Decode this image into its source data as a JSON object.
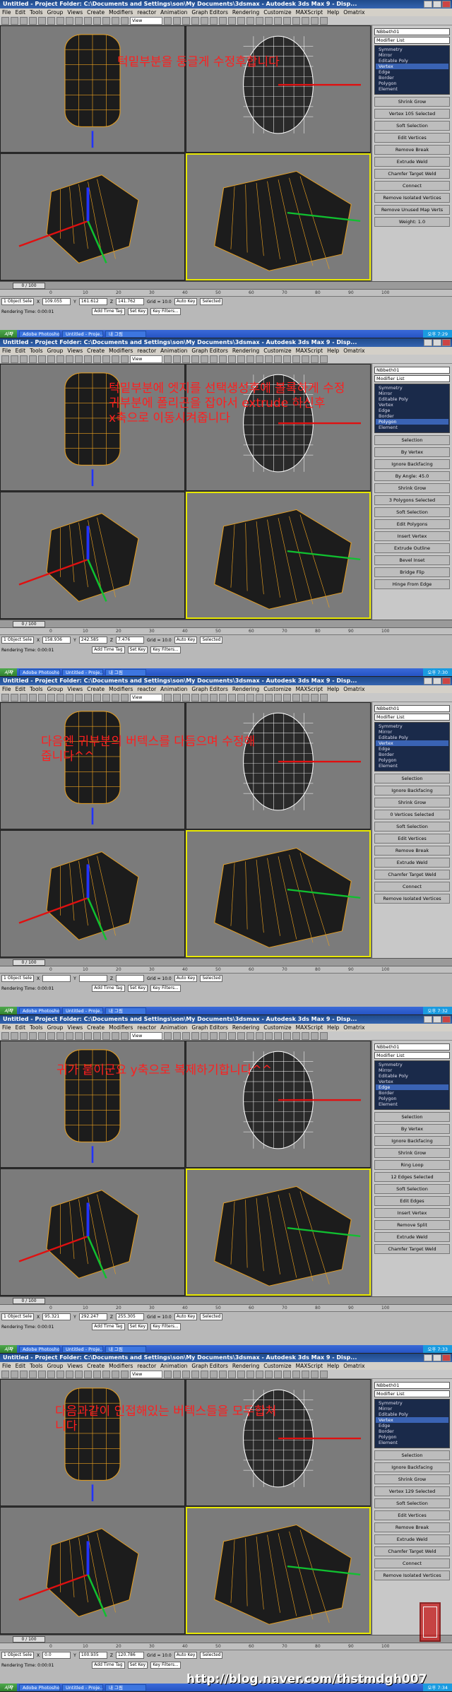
{
  "app": {
    "window_title": "Untitled   - Project Folder: C:\\Documents and Settings\\son\\My Documents\\3dsmax   - Autodesk 3ds Max 9   - Disp...",
    "menus": [
      "File",
      "Edit",
      "Tools",
      "Group",
      "Views",
      "Create",
      "Modifiers",
      "reactor",
      "Animation",
      "Graph Editors",
      "Rendering",
      "Customize",
      "MAXScript",
      "Help",
      "Omatrix"
    ],
    "viewport_label": "View",
    "object_name": "NBbeth01",
    "modifier_list": "Modifier List"
  },
  "frames": [
    {
      "note": "턱밑부분을 둥글게 수정후합니다",
      "stack": [
        "Symmetry",
        "Mirror",
        "Editable Poly",
        "Vertex",
        "Edge",
        "Border",
        "Polygon",
        "Element"
      ],
      "stack_hl": 3,
      "rollouts": [
        "Shrink   Grow",
        "Vertex 105 Selected",
        "Soft Selection",
        "Edit Vertices",
        "Remove   Break",
        "Extrude   Weld",
        "Chamfer   Target Weld",
        "Connect",
        "Remove Isolated Vertices",
        "Remove Unused Map Verts",
        "Weight: 1.0"
      ],
      "frame_counter": "0 / 100",
      "selection": "1 Object Sele",
      "coords": {
        "x": "109.055",
        "y": "161.612",
        "z": "141.762"
      },
      "grid": "Grid = 10.0",
      "render_time": "Rendering Time: 0:00:01",
      "add_time_tag": "Add Time Tag",
      "clock": "오후 7:29"
    },
    {
      "note": "턱밑부분에 엣지를 선택생성후에 볼록하게 수정\n귀부분에 폴리곤을 잡아서 extrude 하신후\nx축으로 이동시켜줍니다",
      "stack": [
        "Symmetry",
        "Mirror",
        "Editable Poly",
        "Vertex",
        "Edge",
        "Border",
        "Polygon",
        "Element"
      ],
      "stack_hl": 6,
      "rollouts": [
        "Selection",
        "By Vertex",
        "Ignore Backfacing",
        "By Angle: 45.0",
        "Shrink   Grow",
        "3 Polygons Selected",
        "Soft Selection",
        "Edit Polygons",
        "Insert Vertex",
        "Extrude   Outline",
        "Bevel   Inset",
        "Bridge   Flip",
        "Hinge From Edge"
      ],
      "frame_counter": "0 / 100",
      "selection": "1 Object Sele",
      "coords": {
        "x": "158.936",
        "y": "242.585",
        "z": "7.476"
      },
      "grid": "Grid = 10.0",
      "render_time": "Rendering Time: 0:00:01",
      "add_time_tag": "Add Time Tag",
      "clock": "오후 7:30"
    },
    {
      "note": "다음엔 귀부분의 버텍스를 다듬으며 수정해\n줍니다^^",
      "stack": [
        "Symmetry",
        "Mirror",
        "Editable Poly",
        "Vertex",
        "Edge",
        "Border",
        "Polygon",
        "Element"
      ],
      "stack_hl": 3,
      "rollouts": [
        "Selection",
        "Ignore Backfacing",
        "Shrink   Grow",
        "0 Vertices Selected",
        "Soft Selection",
        "Edit Vertices",
        "Remove   Break",
        "Extrude   Weld",
        "Chamfer   Target Weld",
        "Connect",
        "Remove Isolated Vertices"
      ],
      "frame_counter": "0 / 100",
      "selection": "1 Object Sele",
      "coords": {
        "x": "",
        "y": "",
        "z": ""
      },
      "grid": "Grid = 10.0",
      "render_time": "Rendering Time: 0:00:01",
      "add_time_tag": "Add Time Tag",
      "clock": "오후 7:32"
    },
    {
      "note": "귀가 붙이군요 y축으로 복제하기합니다^^",
      "stack": [
        "Symmetry",
        "Mirror",
        "Editable Poly",
        "Vertex",
        "Edge",
        "Border",
        "Polygon",
        "Element"
      ],
      "stack_hl": 4,
      "rollouts": [
        "Selection",
        "By Vertex",
        "Ignore Backfacing",
        "Shrink   Grow",
        "Ring   Loop",
        "12 Edges Selected",
        "Soft Selection",
        "Edit Edges",
        "Insert Vertex",
        "Remove   Split",
        "Extrude   Weld",
        "Chamfer   Target Weld"
      ],
      "frame_counter": "0 / 100",
      "selection": "1 Object Sele",
      "coords": {
        "x": "95.321",
        "y": "292.247",
        "z": "255.305"
      },
      "grid": "Grid = 10.0",
      "render_time": "Rendering Time: 0:00:01",
      "add_time_tag": "Add Time Tag",
      "clock": "오후 7:33"
    },
    {
      "note": "다음과같이 인접해있는 버텍스들을 모두합쳐\n니다",
      "stack": [
        "Symmetry",
        "Mirror",
        "Editable Poly",
        "Vertex",
        "Edge",
        "Border",
        "Polygon",
        "Element"
      ],
      "stack_hl": 3,
      "rollouts": [
        "Selection",
        "Ignore Backfacing",
        "Shrink   Grow",
        "Vertex 129 Selected",
        "Soft Selection",
        "Edit Vertices",
        "Remove   Break",
        "Extrude   Weld",
        "Chamfer   Target Weld",
        "Connect",
        "Remove Isolated Vertices"
      ],
      "frame_counter": "0 / 100",
      "selection": "1 Object Sele",
      "coords": {
        "x": "0.0",
        "y": "100.935",
        "z": "120.786"
      },
      "grid": "Grid = 10.0",
      "render_time": "Rendering Time: 0:00:01",
      "add_time_tag": "Add Time Tag",
      "clock": "오후 7:34"
    }
  ],
  "labels": {
    "auto_key": "Auto Key",
    "set_key": "Set Key",
    "selected": "Selected",
    "key_filters": "Key Filters...",
    "start": "시작",
    "tasks": [
      "Adobe Photoshop",
      "Untitled - Proje...",
      "내 그림"
    ]
  },
  "ruler_ticks": [
    "0",
    "10",
    "20",
    "30",
    "40",
    "50",
    "60",
    "70",
    "80",
    "90",
    "100"
  ],
  "watermark": "http://blog.naver.com/thstmdgh007",
  "colors": {
    "note": "#ff1e1e",
    "title_bar": "#2a58a0",
    "taskbar": "#2f5fcf",
    "viewport_bg": "#7b7b7b",
    "mesh_wire": "#e8a020",
    "mesh_fill": "#1c1c1c"
  }
}
